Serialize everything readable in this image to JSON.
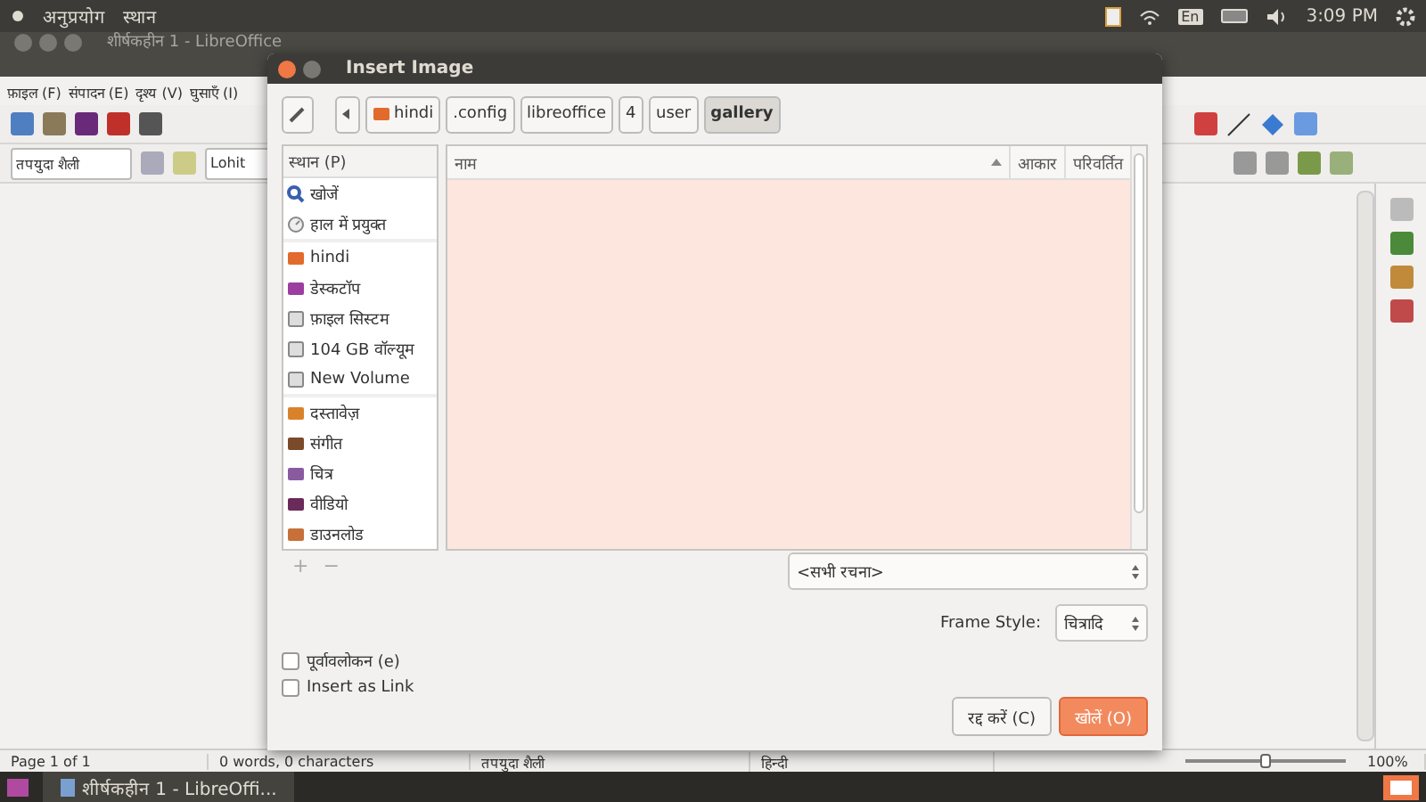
{
  "top_panel": {
    "menus": [
      "अनुप्रयोग",
      "स्थान"
    ],
    "keyboard": "En",
    "time": "3:09 PM"
  },
  "writer": {
    "title": "शीर्षकहीन 1 - LibreOffice",
    "menu": [
      "फ़ाइल (F)",
      "संपादन (E)",
      "दृश्य (V)",
      "घुसाएँ (I)"
    ],
    "style_box": {
      "value": "तपयुदा शैली"
    },
    "font_box": {
      "value": "Lohit"
    }
  },
  "status_bar": {
    "page": "Page 1 of 1",
    "words": "0 words, 0 characters",
    "style": "तपयुदा शैली",
    "language": "हिन्दी",
    "zoom_slider": {
      "level": 0.5
    },
    "zoom": "100%"
  },
  "taskbar": {
    "item": "शीर्षकहीन 1 - LibreOffi..."
  },
  "dialog": {
    "title": "Insert Image",
    "path": [
      {
        "label": "hindi",
        "kind": "home",
        "selected": false
      },
      {
        "label": ".config",
        "kind": "plain",
        "selected": false
      },
      {
        "label": "libreoffice",
        "kind": "plain",
        "selected": false
      },
      {
        "label": "4",
        "kind": "plain",
        "selected": false
      },
      {
        "label": "user",
        "kind": "plain",
        "selected": false
      },
      {
        "label": "gallery",
        "kind": "plain",
        "selected": true
      }
    ],
    "places_header": "स्थान (P)",
    "places": [
      [
        {
          "label": "खोजें",
          "kind": "search"
        },
        {
          "label": "हाल में प्रयुक्त",
          "kind": "recent"
        }
      ],
      [
        {
          "label": "hindi",
          "kind": "home"
        },
        {
          "label": "डेस्कटॉप",
          "kind": "desktop"
        },
        {
          "label": "फ़ाइल सिस्टम",
          "kind": "drive"
        },
        {
          "label": "104 GB वॉल्यूम",
          "kind": "drive"
        },
        {
          "label": "New Volume",
          "kind": "drive"
        }
      ],
      [
        {
          "label": "दस्तावेज़",
          "kind": "documents"
        },
        {
          "label": "संगीत",
          "kind": "music"
        },
        {
          "label": "चित्र",
          "kind": "pictures"
        },
        {
          "label": "वीडियो",
          "kind": "videos"
        },
        {
          "label": "डाउनलोड",
          "kind": "downloads"
        }
      ]
    ],
    "places_buttons": [
      "+",
      "−"
    ],
    "columns": [
      "नाम",
      "आकार",
      "परिवर्तित"
    ],
    "filter": "<सभी रचना>",
    "frame_style": {
      "label": "Frame Style:",
      "value": "चित्रादि"
    },
    "options": [
      {
        "label": "पूर्वावलोकन (e)",
        "checked": false
      },
      {
        "label": "Insert as Link",
        "checked": false
      }
    ],
    "buttons": [
      {
        "label": "रद्द करें (C)",
        "kind": "normal"
      },
      {
        "label": "खोलें (O)",
        "kind": "primary"
      }
    ]
  }
}
